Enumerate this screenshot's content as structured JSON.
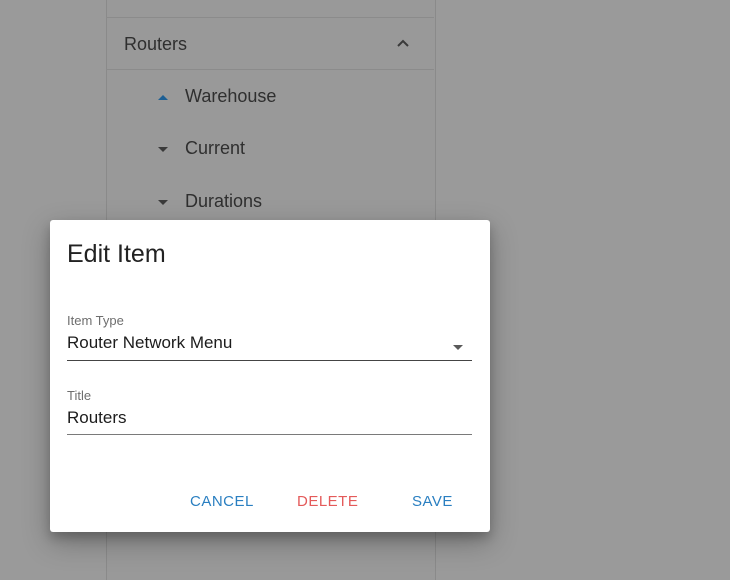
{
  "background": {
    "section": {
      "title": "Routers",
      "expand_icon": "chevron-up-icon"
    },
    "items": [
      {
        "label": "Warehouse",
        "sort_icon": "sort-up-icon"
      },
      {
        "label": "Current",
        "sort_icon": "sort-down-icon"
      },
      {
        "label": "Durations",
        "sort_icon": "sort-down-icon"
      }
    ]
  },
  "dialog": {
    "title": "Edit Item",
    "item_type": {
      "label": "Item Type",
      "value": "Router Network Menu",
      "icon": "dropdown-arrow-icon"
    },
    "title_field": {
      "label": "Title",
      "value": "Routers"
    },
    "actions": {
      "cancel_label": "CANCEL",
      "delete_label": "DELETE",
      "save_label": "SAVE"
    }
  },
  "colors": {
    "overlay": "#9a9a9a",
    "primary": "#2a7fc1",
    "danger": "#e45a5a",
    "sort_active": "#1d5f94"
  }
}
